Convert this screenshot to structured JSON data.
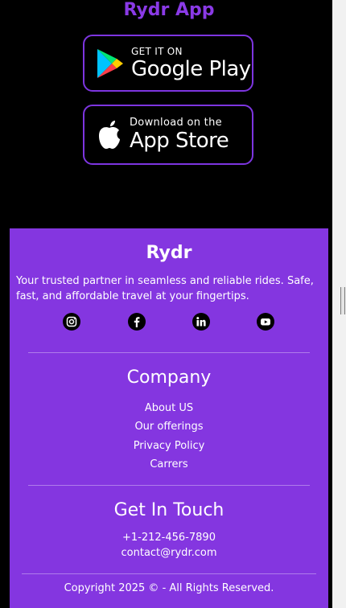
{
  "app_title": "Rydr App",
  "badges": {
    "google_play": {
      "small": "GET IT ON",
      "big": "Google Play"
    },
    "app_store": {
      "small": "Download on the",
      "big": "App Store"
    }
  },
  "footer": {
    "brand": "Rydr",
    "description": "Your trusted partner in seamless and reliable rides. Safe, fast, and affordable travel at your fingertips.",
    "social_icons": [
      "instagram-icon",
      "facebook-icon",
      "linkedin-icon",
      "youtube-icon"
    ],
    "company": {
      "heading": "Company",
      "links": [
        "About US",
        "Our offerings",
        "Privacy Policy",
        "Carrers"
      ]
    },
    "contact": {
      "heading": "Get In Touch",
      "phone": "+1-212-456-7890",
      "email": "contact@rydr.com"
    },
    "copyright": "Copyright 2025 © - All Rights Reserved."
  },
  "colors": {
    "accent": "#8436e0",
    "title": "#8a3ae6",
    "background": "#000000"
  }
}
